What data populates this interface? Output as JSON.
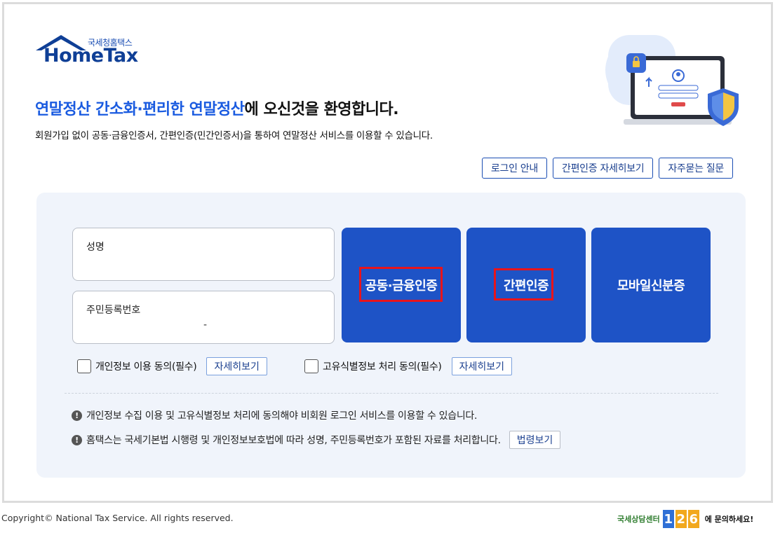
{
  "logo": {
    "kr": "국세청홈택스",
    "en": "HomeTax"
  },
  "hero": {
    "title_highlight": "연말정산 간소화·편리한 연말정산",
    "title_rest": "에 오신것을 환영합니다.",
    "description": "회원가입 없이 공동·금융인증서, 간편인증(민간인증서)을 통하여 연말정산 서비스를 이용할 수 있습니다."
  },
  "top_buttons": {
    "login_guide": "로그인 안내",
    "simple_auth_detail": "간편인증 자세히보기",
    "faq": "자주묻는 질문"
  },
  "form": {
    "name_label": "성명",
    "rrn_label": "주민등록번호",
    "rrn_separator": "-"
  },
  "auth_buttons": {
    "joint_financial": "공동·금융인증",
    "simple": "간편인증",
    "mobile_id": "모바일신분증"
  },
  "agreements": {
    "privacy": "개인정보 이용 동의(필수)",
    "unique_id": "고유식별정보 처리 동의(필수)",
    "detail": "자세히보기"
  },
  "notices": {
    "n1": "개인정보 수집 이용 및 고유식별정보 처리에 동의해야 비회원 로그인 서비스를 이용할 수 있습니다.",
    "n2": "홈택스는 국세기본법 시행령 및 개인정보보호법에 따라 성명, 주민등록번호가 포함된 자료를 처리합니다.",
    "law_button": "법령보기"
  },
  "footer": {
    "copyright": "Copyright© National Tax Service. All rights reserved.",
    "center_label": "국세상담센터",
    "number": [
      "1",
      "2",
      "6"
    ],
    "suffix": "에 문의하세요!"
  },
  "colors": {
    "primary": "#1e53c6",
    "highlight_text": "#1a5be0",
    "panel_bg": "#f0f4fb",
    "annotation_box": "#e8141b"
  }
}
